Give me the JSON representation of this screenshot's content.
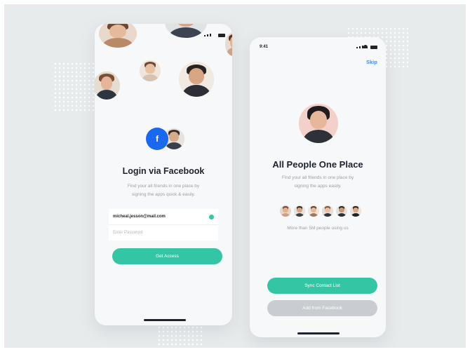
{
  "colors": {
    "accent": "#34c6a4",
    "facebook": "#1a67f0",
    "link": "#3b8ff0",
    "disabled": "#c9ccd0",
    "background": "#e7ebec"
  },
  "login_screen": {
    "facebook_badge_icon": "facebook-icon",
    "title": "Login via Facebook",
    "subtitle_line1": "Find your all friends in one place by",
    "subtitle_line2": "signing the apps quick & easily.",
    "email_value": "micheal.jesson@mail.com",
    "password_placeholder": "Enter Password",
    "button_label": "Get Access"
  },
  "people_screen": {
    "status_time": "9:41",
    "skip_label": "Skip",
    "title": "All People One Place",
    "subtitle_line1": "Find your all friends in one place by",
    "subtitle_line2": "signing the apps easily.",
    "people_caption": "More than 5M people using us",
    "sync_button_label": "Sync Contact List",
    "add_button_label": "Add from Facebook"
  }
}
